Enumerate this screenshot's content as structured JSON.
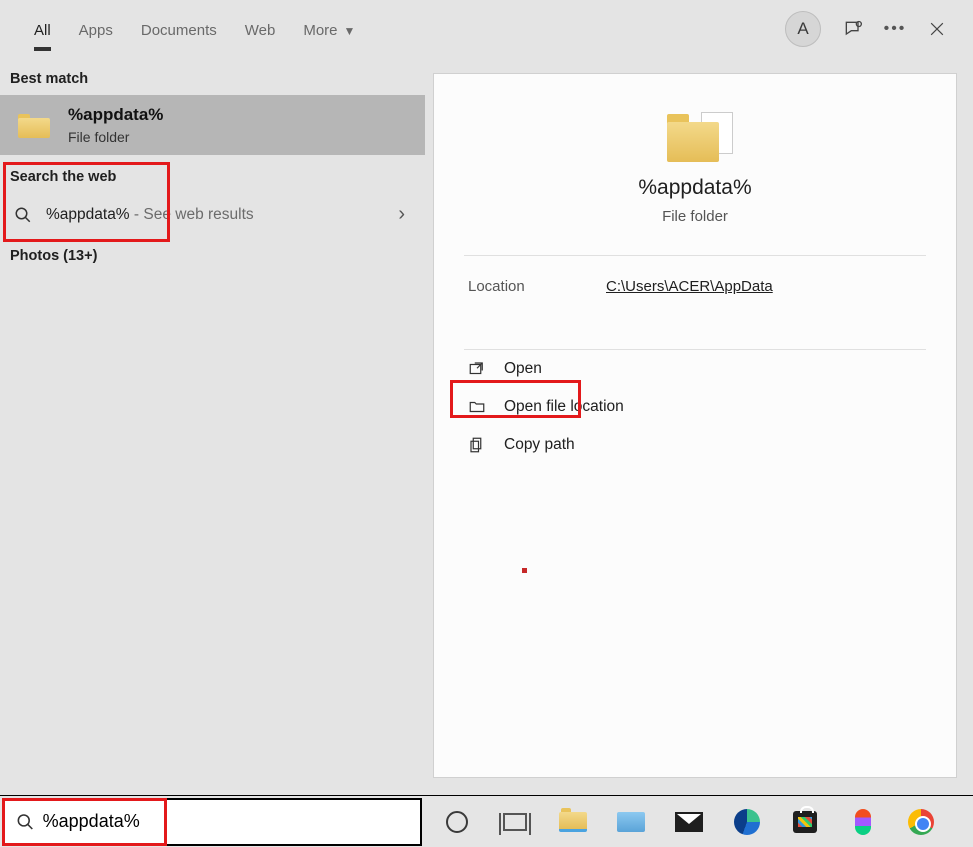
{
  "tabs": {
    "all": "All",
    "apps": "Apps",
    "documents": "Documents",
    "web": "Web",
    "more": "More"
  },
  "topbar": {
    "avatar_initial": "A"
  },
  "left": {
    "best_match_header": "Best match",
    "best_match": {
      "title": "%appdata%",
      "subtitle": "File folder"
    },
    "web_header": "Search the web",
    "web_row": {
      "term": "%appdata%",
      "suffix": " - See web results"
    },
    "photos_header": "Photos (13+)"
  },
  "preview": {
    "title": "%appdata%",
    "subtitle": "File folder",
    "location_label": "Location",
    "location_value": "C:\\Users\\ACER\\AppData",
    "actions": {
      "open": "Open",
      "open_loc": "Open file location",
      "copy_path": "Copy path"
    }
  },
  "search": {
    "value": "%appdata%"
  }
}
